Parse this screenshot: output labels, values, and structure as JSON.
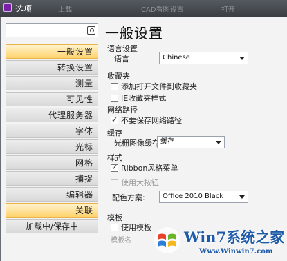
{
  "window": {
    "title": "选项",
    "ghost_tabs": [
      "上载",
      "CAD看图设置",
      "打开"
    ]
  },
  "sidebar": {
    "search": {
      "value": "",
      "placeholder": ""
    },
    "items": [
      {
        "label": "一般设置",
        "active": true
      },
      {
        "label": "转换设置",
        "active": false
      },
      {
        "label": "测量",
        "active": false
      },
      {
        "label": "可见性",
        "active": false
      },
      {
        "label": "代理服务器",
        "active": false
      },
      {
        "label": "字体",
        "active": false
      },
      {
        "label": "光标",
        "active": false
      },
      {
        "label": "网格",
        "active": false
      },
      {
        "label": "捕捉",
        "active": false
      },
      {
        "label": "编辑器",
        "active": false
      },
      {
        "label": "关联",
        "active": true
      },
      {
        "label": "加载中/保存中",
        "active": false
      }
    ]
  },
  "main": {
    "title": "一般设置",
    "language": {
      "section": "语言设置",
      "label": "语言",
      "value": "Chinese"
    },
    "favorites": {
      "section": "收藏夹",
      "add_open_files": {
        "label": "添加打开文件到收藏夹",
        "checked": false
      },
      "ie_style": {
        "label": "IE收藏夹样式",
        "checked": false
      }
    },
    "network": {
      "section": "网络路径",
      "no_save_path": {
        "label": "不要保存网络路径",
        "checked": true
      }
    },
    "cache": {
      "section": "缓存",
      "raster_label": "光栅图像缓存:",
      "raster_value": "缓存"
    },
    "style": {
      "section": "样式",
      "ribbon_menu": {
        "label": "Ribbon风格菜单",
        "checked": true
      },
      "large_buttons": {
        "label": "使用大按钮",
        "checked": false,
        "disabled": true
      },
      "color_scheme_label": "配色方案:",
      "color_scheme_value": "Office 2010 Black"
    },
    "template": {
      "section": "模板",
      "use_template": {
        "label": "使用模板",
        "checked": false
      },
      "template_name_label": "模板名"
    }
  },
  "watermark": {
    "brand": "Win7系统之家",
    "url": "Www.Winwin7.com"
  },
  "colors": {
    "active_nav": "#ffd36d",
    "titlebar": "#3b3f44",
    "watermark_blue": "#1d5aa8"
  }
}
